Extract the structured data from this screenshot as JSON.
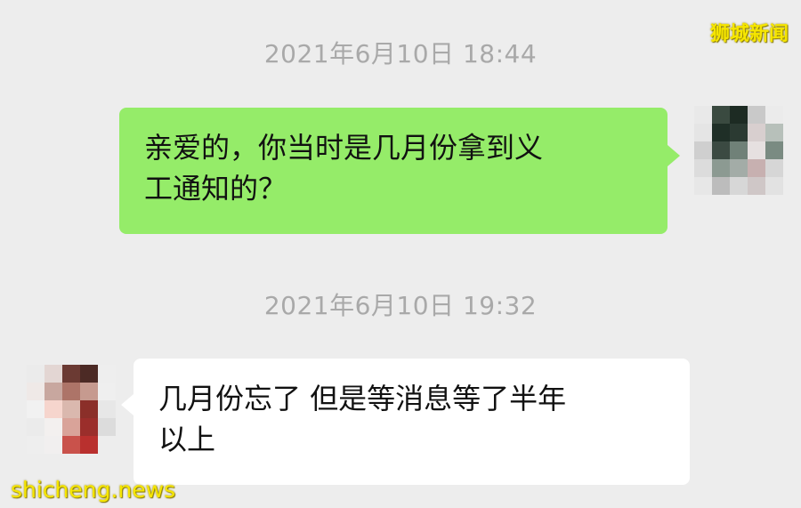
{
  "watermarks": {
    "top": "狮城新闻",
    "bottom": "shicheng.news"
  },
  "chat": {
    "messages": [
      {
        "timestamp": "2021年6月10日 18:44",
        "sender": "self",
        "text": "亲爱的，你当时是几月份拿到义\n工通知的？"
      },
      {
        "timestamp": "2021年6月10日 19:32",
        "sender": "other",
        "text": "几月份忘了 但是等消息等了半年\n以上"
      }
    ]
  },
  "colors": {
    "background": "#ededed",
    "outgoing_bubble": "#95ec69",
    "incoming_bubble": "#ffffff",
    "timestamp_text": "#a9a9a9",
    "watermark": "#f6e600"
  },
  "avatars": {
    "self": [
      "#e9e9e9",
      "#3a4a40",
      "#1d2b23",
      "#c9c9c9",
      "#ebebeb",
      "#e5e5e5",
      "#1f2f27",
      "#2b3a32",
      "#d8cfcf",
      "#b7c0ba",
      "#cfcfcf",
      "#3b4a42",
      "#708178",
      "#e6e0e0",
      "#7a8b82",
      "#dcdcdc",
      "#8c9a92",
      "#a3aca7",
      "#c7b0b0",
      "#d6d6d6",
      "#e7e7e7",
      "#bcbcbc",
      "#d7d7d7",
      "#cfc7c7",
      "#e2e2e2"
    ],
    "other": [
      "#ebebeb",
      "#e3d6d3",
      "#6b3a33",
      "#4c2a25",
      "#eeeeee",
      "#efe9e7",
      "#c8a79f",
      "#ad7468",
      "#c69a8f",
      "#efefef",
      "#f1f1f1",
      "#f6d5cd",
      "#dab8ae",
      "#8b2f29",
      "#e7e7e7",
      "#ebebeb",
      "#f3f0ef",
      "#d9a399",
      "#9b2e2b",
      "#dcdcdc",
      "#eeeeee",
      "#f1efef",
      "#c9524b",
      "#b9302e",
      "#ededed"
    ]
  }
}
